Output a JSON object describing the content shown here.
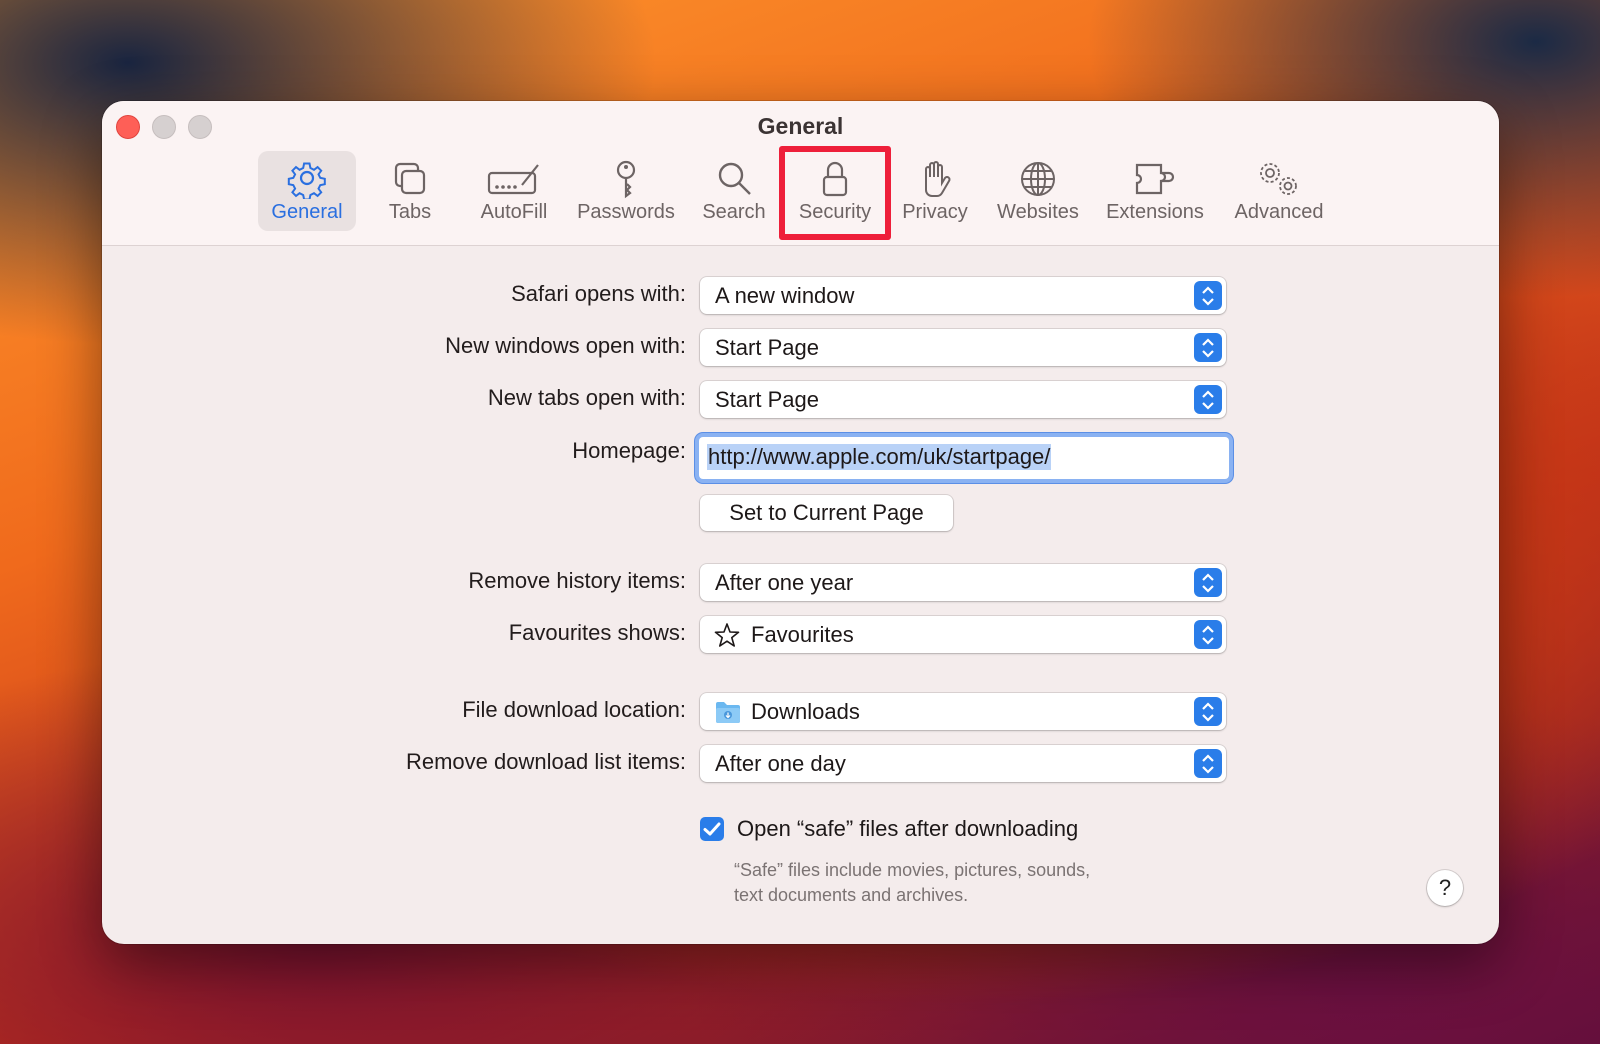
{
  "window": {
    "title": "General"
  },
  "toolbar": {
    "items": [
      {
        "label": "General",
        "icon": "gear-icon",
        "selected": true
      },
      {
        "label": "Tabs",
        "icon": "tabs-icon"
      },
      {
        "label": "AutoFill",
        "icon": "autofill-icon"
      },
      {
        "label": "Passwords",
        "icon": "key-icon"
      },
      {
        "label": "Search",
        "icon": "search-icon"
      },
      {
        "label": "Security",
        "icon": "lock-icon",
        "highlighted": true
      },
      {
        "label": "Privacy",
        "icon": "hand-icon"
      },
      {
        "label": "Websites",
        "icon": "globe-icon"
      },
      {
        "label": "Extensions",
        "icon": "puzzle-icon"
      },
      {
        "label": "Advanced",
        "icon": "gears-icon"
      }
    ]
  },
  "settings": {
    "safari_opens_with": {
      "label": "Safari opens with:",
      "value": "A new window"
    },
    "new_windows_open_with": {
      "label": "New windows open with:",
      "value": "Start Page"
    },
    "new_tabs_open_with": {
      "label": "New tabs open with:",
      "value": "Start Page"
    },
    "homepage": {
      "label": "Homepage:",
      "value": "http://www.apple.com/uk/startpage/"
    },
    "set_current_page": {
      "label": "Set to Current Page"
    },
    "remove_history": {
      "label": "Remove history items:",
      "value": "After one year"
    },
    "favourites_shows": {
      "label": "Favourites shows:",
      "value": "Favourites",
      "icon": "star-icon"
    },
    "download_location": {
      "label": "File download location:",
      "value": "Downloads",
      "icon": "folder-icon"
    },
    "remove_download_items": {
      "label": "Remove download list items:",
      "value": "After one day"
    },
    "open_safe_files": {
      "label": "Open “safe” files after downloading",
      "checked": true,
      "note_line1": "“Safe” files include movies, pictures, sounds,",
      "note_line2": "text documents and archives."
    }
  },
  "help": {
    "label": "?"
  },
  "colors": {
    "accent": "#2a7de9",
    "highlight": "#ee1f3a",
    "close": "#fe5f57"
  }
}
